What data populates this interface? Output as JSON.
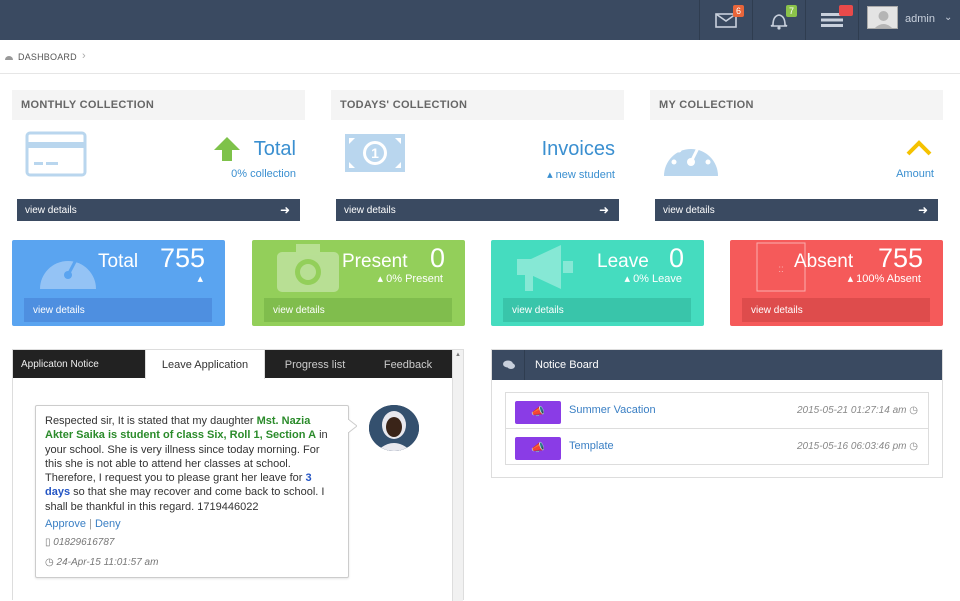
{
  "topbar": {
    "mail_badge": "6",
    "bell_badge": "7",
    "tasks_badge": "",
    "user_name": "admin",
    "colors": {
      "mail": "#e8653a",
      "bell": "#8bc34a",
      "tasks": "#e84a4a"
    }
  },
  "breadcrumb": {
    "label": "DASHBOARD"
  },
  "collections": [
    {
      "head": "MONTHLY COLLECTION",
      "title": "Total",
      "sub": "0% collection",
      "link": "view details"
    },
    {
      "head": "TODAYS' COLLECTION",
      "title": "Invoices",
      "sub": "new student",
      "link": "view details"
    },
    {
      "head": "MY COLLECTION",
      "title": "",
      "sub": "Amount",
      "link": "view details"
    }
  ],
  "stats": [
    {
      "label": "Total",
      "num": "755",
      "sub": "",
      "link": "view details",
      "color": "#5aa4f0",
      "bar": "#4e8fe0"
    },
    {
      "label": "Present",
      "num": "0",
      "sub": "0% Present",
      "link": "view details",
      "color": "#93cf5a",
      "bar": "#80bd4d"
    },
    {
      "label": "Leave",
      "num": "0",
      "sub": "0% Leave",
      "link": "view details",
      "color": "#45dcbf",
      "bar": "#39c5aa"
    },
    {
      "label": "Absent",
      "num": "755",
      "sub": "100% Absent",
      "link": "view details",
      "color": "#f55a5a",
      "bar": "#de4c4c"
    }
  ],
  "application": {
    "tabs": [
      "Applicaton Notice",
      "Leave Application",
      "Progress list",
      "Feedback"
    ],
    "text_1": "Respected sir, It is stated that my daughter ",
    "bold_1": "Mst. Nazia Akter Saika is student of class Six, Roll 1, Section A",
    "text_2": " in your school. She is very illness since today morning. For this she is not able to attend her classes at school. Therefore, I request you to please grant her leave for ",
    "bold_2": "3 days",
    "text_3": " so that she may recover and come back to school. I shall be thankful in this regard. 1719446022",
    "approve": "Approve",
    "separator": "|",
    "deny": "Deny",
    "phone": "01829616787",
    "time": "24-Apr-15 11:01:57 am"
  },
  "notice_board": {
    "title": "Notice Board",
    "items": [
      {
        "title": "Summer Vacation",
        "date": "2015-05-21 01:27:14 am"
      },
      {
        "title": "Template",
        "date": "2015-05-16 06:03:46 pm"
      }
    ]
  }
}
